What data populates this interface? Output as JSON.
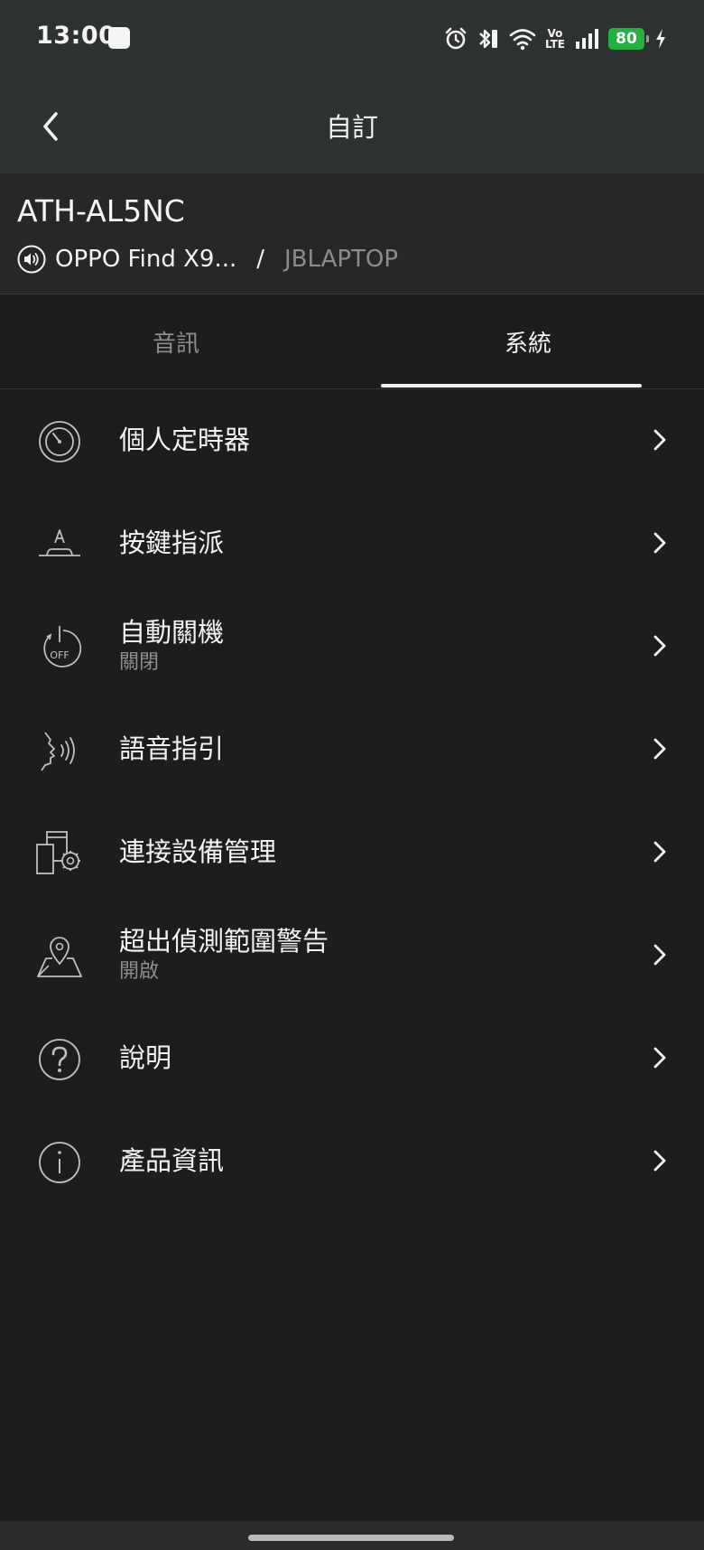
{
  "status_bar": {
    "time": "13:00",
    "battery": "80",
    "volte_top": "Vo",
    "volte_bottom": "LTE",
    "icons": [
      "app-icon",
      "alarm-icon",
      "bluetooth-icon",
      "wifi-icon",
      "volte-icon",
      "signal-icon",
      "battery-icon",
      "charging-icon"
    ]
  },
  "app_bar": {
    "title": "自訂",
    "back_icon": "chevron-left-icon"
  },
  "device": {
    "name": "ATH-AL5NC",
    "source_icon": "speaker-icon",
    "source_primary": "OPPO Find X9...",
    "separator": "/",
    "source_secondary": "JBLAPTOP"
  },
  "tabs": [
    {
      "label": "音訊",
      "active": false
    },
    {
      "label": "系統",
      "active": true
    }
  ],
  "menu": {
    "items": [
      {
        "label": "個人定時器",
        "sub": "",
        "icon": "timer-icon"
      },
      {
        "label": "按鍵指派",
        "sub": "",
        "icon": "key-assign-icon"
      },
      {
        "label": "自動關機",
        "sub": "關閉",
        "icon": "auto-power-off-icon"
      },
      {
        "label": "語音指引",
        "sub": "",
        "icon": "voice-guidance-icon"
      },
      {
        "label": "連接設備管理",
        "sub": "",
        "icon": "device-management-icon"
      },
      {
        "label": "超出偵測範圍警告",
        "sub": "開啟",
        "icon": "location-pin-icon"
      },
      {
        "label": "說明",
        "sub": "",
        "icon": "help-icon"
      },
      {
        "label": "產品資訊",
        "sub": "",
        "icon": "info-icon"
      }
    ],
    "chevron_icon": "chevron-right-icon"
  },
  "colors": {
    "background": "#1c1d1d",
    "bar": "#2f3233",
    "header": "#262828",
    "text": "#f4f4f4",
    "muted": "#8b8d8d",
    "battery": "#25b13f"
  }
}
